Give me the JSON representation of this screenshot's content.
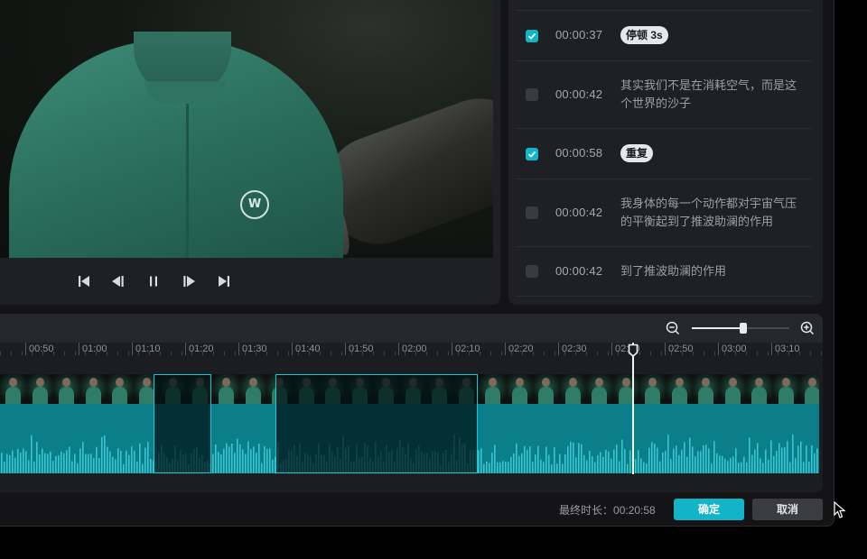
{
  "player": {
    "logo_text": "W",
    "controls": [
      "skip-to-start",
      "step-back",
      "pause",
      "step-forward",
      "skip-to-end"
    ]
  },
  "segments": [
    {
      "checked": true,
      "time": "00:00:37",
      "tag": "停顿 3s"
    },
    {
      "checked": false,
      "time": "00:00:42",
      "text": "其实我们不是在消耗空气，而是这个世界的沙子"
    },
    {
      "checked": true,
      "time": "00:00:58",
      "tag": "重复"
    },
    {
      "checked": false,
      "time": "00:00:42",
      "text": "我身体的每一个动作都对宇宙气压的平衡起到了推波助澜的作用"
    },
    {
      "checked": false,
      "time": "00:00:42",
      "text": "到了推波助澜的作用"
    }
  ],
  "timeline": {
    "zoom_level": 0.53,
    "ticks": [
      "00:50",
      "01:00",
      "01:10",
      "01:20",
      "01:30",
      "01:40",
      "01:50",
      "02:00",
      "02:10",
      "02:20",
      "02:30",
      "02:40",
      "02:50",
      "03:00",
      "03:10"
    ],
    "selections": [
      {
        "start": "01:14",
        "end": "01:25"
      },
      {
        "start": "01:37",
        "end": "02:15"
      }
    ],
    "playhead": "02:44",
    "zoom_out_icon": "zoom-out-icon",
    "zoom_in_icon": "zoom-in-icon"
  },
  "footer": {
    "duration_label": "最终时长：",
    "duration_value": "00:20:58",
    "confirm_label": "确定",
    "cancel_label": "取消"
  },
  "colors": {
    "accent": "#12b5c7",
    "waveform": "#0a7f89",
    "panel": "#1f2023",
    "background": "#141416"
  }
}
